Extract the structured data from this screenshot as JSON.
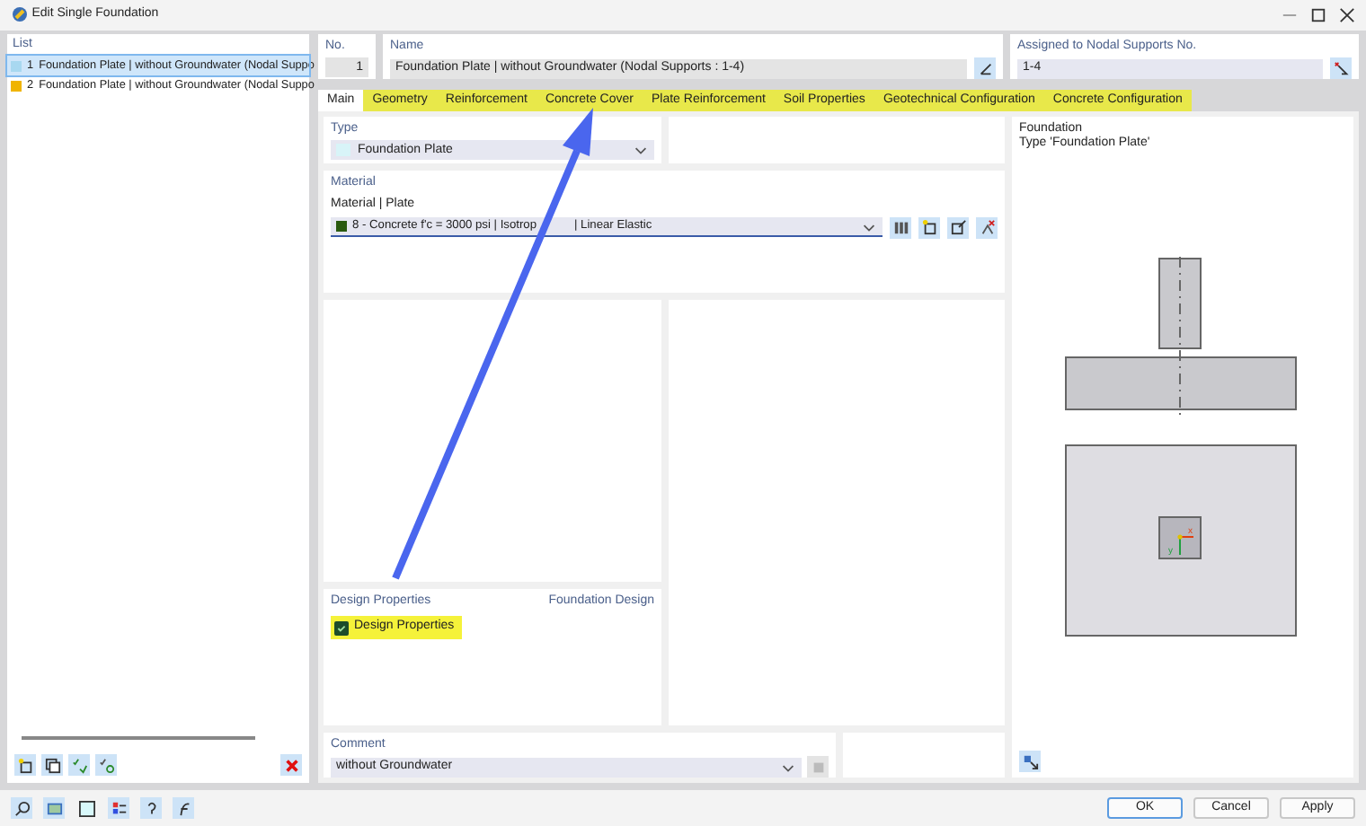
{
  "window": {
    "title": "Edit Single Foundation"
  },
  "list": {
    "header": "List",
    "items": [
      {
        "number": "1",
        "label": "Foundation Plate | without Groundwater (Nodal Suppo",
        "color": "#a8d8f0",
        "selected": true
      },
      {
        "number": "2",
        "label": "Foundation Plate | without Groundwater (Nodal Suppo",
        "color": "#f0b400",
        "selected": false
      }
    ]
  },
  "number": {
    "label": "No.",
    "value": "1"
  },
  "name": {
    "label": "Name",
    "value": "Foundation Plate | without Groundwater (Nodal Supports : 1-4)"
  },
  "assigned": {
    "label": "Assigned to Nodal Supports No.",
    "value": "1-4"
  },
  "tabs": [
    {
      "label": "Main",
      "selected": true,
      "highlighted": false
    },
    {
      "label": "Geometry",
      "selected": false,
      "highlighted": true
    },
    {
      "label": "Reinforcement",
      "selected": false,
      "highlighted": true
    },
    {
      "label": "Concrete Cover",
      "selected": false,
      "highlighted": true
    },
    {
      "label": "Plate Reinforcement",
      "selected": false,
      "highlighted": true
    },
    {
      "label": "Soil Properties",
      "selected": false,
      "highlighted": true
    },
    {
      "label": "Geotechnical Configuration",
      "selected": false,
      "highlighted": true
    },
    {
      "label": "Concrete Configuration",
      "selected": false,
      "highlighted": true
    }
  ],
  "type": {
    "header": "Type",
    "value": "Foundation Plate"
  },
  "material": {
    "header": "Material",
    "label": "Material | Plate",
    "value_start": "8 - Concrete f'c = 3000 psi | Isotrop",
    "value_end": "| Linear Elastic"
  },
  "design_properties": {
    "header": "Design Properties",
    "header_right": "Foundation Design",
    "checkbox": {
      "label": "Design Properties",
      "checked": true,
      "highlighted": true
    }
  },
  "comment": {
    "header": "Comment",
    "value": "without Groundwater"
  },
  "preview": {
    "title": "Foundation",
    "subtitle": "Type 'Foundation Plate'",
    "axis_x": "x",
    "axis_y": "y"
  },
  "buttons": [
    {
      "label": "OK",
      "default": true
    },
    {
      "label": "Cancel",
      "default": false
    },
    {
      "label": "Apply",
      "default": false
    }
  ]
}
